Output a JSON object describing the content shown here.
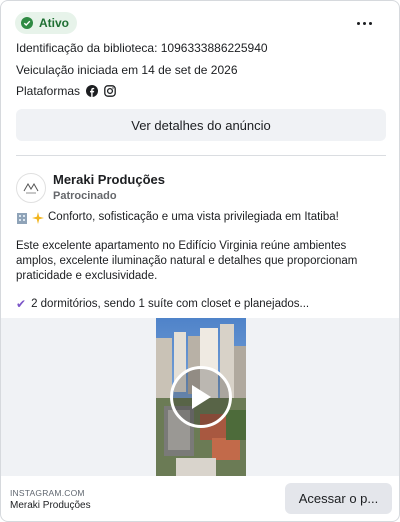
{
  "status": {
    "label": "Ativo",
    "color": "#2f8a43"
  },
  "menu": {
    "icon": "more-horizontal-icon"
  },
  "library": {
    "id_line": "Identificação da biblioteca: 1096333886225940",
    "start_line": "Veiculação iniciada em 14 de set de 2026",
    "platforms_label": "Plataformas",
    "platform_icons": [
      "facebook-icon",
      "instagram-icon"
    ]
  },
  "details_button": {
    "label": "Ver detalhes do anúncio"
  },
  "advertiser": {
    "name": "Meraki Produções",
    "sponsored": "Patrocinado"
  },
  "ad": {
    "headline": "Conforto, sofisticação e uma vista privilegiada em Itatiba!",
    "body": "Este excelente apartamento no Edifício Virginia reúne ambientes amplos, excelente iluminação natural e detalhes que proporcionam praticidade e exclusividade.",
    "bullet": "2 dormitórios, sendo 1 suíte com closet e planejados..."
  },
  "footer": {
    "source": "INSTAGRAM.COM",
    "name": "Meraki Produções",
    "cta": "Acessar o p..."
  }
}
